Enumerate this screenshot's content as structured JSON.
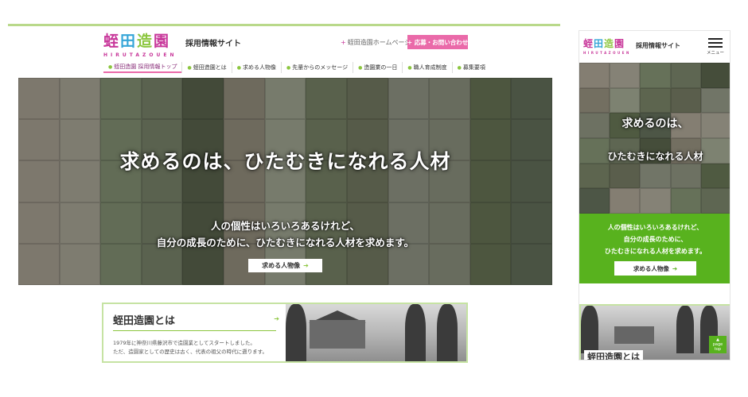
{
  "brand": {
    "logo_chars": [
      "蛭",
      "田",
      "造",
      "園"
    ],
    "logo_colors": [
      "#c8379a",
      "#35a5d7",
      "#8cc63f",
      "#c8379a"
    ],
    "logo_roman": "HIRUTAZOUEN",
    "site_title": "採用情報サイト"
  },
  "desktop": {
    "header": {
      "home_link": "蛭田造園ホームページ",
      "apply_button": "+ 応募・お問い合わせ"
    },
    "nav": [
      {
        "label": "蛭田造園 採用情報トップ",
        "active": true
      },
      {
        "label": "蛭田造園とは",
        "active": false
      },
      {
        "label": "求める人物像",
        "active": false
      },
      {
        "label": "先輩からのメッセージ",
        "active": false
      },
      {
        "label": "造園業の一日",
        "active": false
      },
      {
        "label": "職人育成制度",
        "active": false
      },
      {
        "label": "募集要項",
        "active": false
      }
    ],
    "hero": {
      "catch": "求めるのは、ひたむきになれる人材",
      "sub_line1": "人の個性はいろいろあるけれど、",
      "sub_line2": "自分の成長のために、ひたむきになれる人材を求めます。",
      "cta_label": "求める人物像"
    },
    "about": {
      "title": "蛭田造園とは",
      "desc_line1": "1979年に神奈川県藤沢市で造園業としてスタートしました。",
      "desc_line2": "ただ、造園家としての歴史は古く、代表の祖父の時代に遡ります。"
    }
  },
  "mobile": {
    "menu_label": "メニュー",
    "hero": {
      "catch_line1": "求めるのは、",
      "catch_line2": "ひたむきになれる人材"
    },
    "green": {
      "sub_line1": "人の個性はいろいろあるけれど、",
      "sub_line2": "自分の成長のために、",
      "sub_line3": "ひたむきになれる人材を求めます。",
      "cta_label": "求める人物像"
    },
    "about_title": "蛭田造園とは",
    "page_top_line1": "page",
    "page_top_line2": "top"
  },
  "tile_colors": [
    "#6f7a5c",
    "#8a8f7d",
    "#5d6b4a",
    "#a39b8b",
    "#7b8a6a",
    "#4f5a41",
    "#9aa08a",
    "#6b7158",
    "#858a76",
    "#5a6650",
    "#a4a190",
    "#707b61",
    "#8d8775"
  ],
  "icons": {
    "arrow": "arrow-right-icon",
    "menu": "hamburger-menu-icon"
  }
}
